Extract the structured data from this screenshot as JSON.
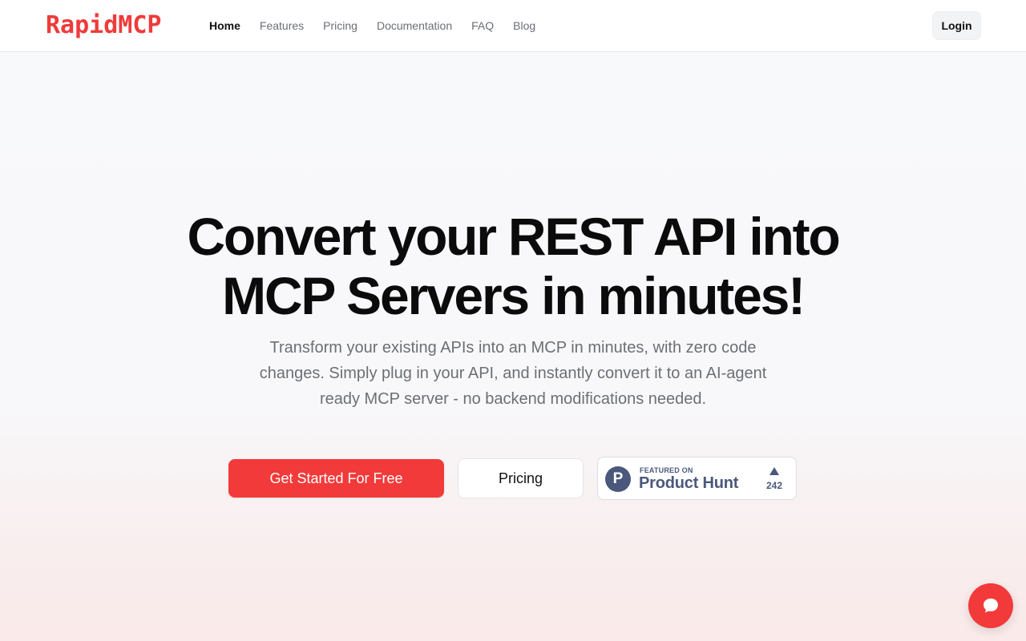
{
  "header": {
    "logo": "RapidMCP",
    "nav": [
      "Home",
      "Features",
      "Pricing",
      "Documentation",
      "FAQ",
      "Blog"
    ],
    "login_label": "Login"
  },
  "hero": {
    "title_line1": "Convert your REST API into",
    "title_line2": "MCP Servers in minutes!",
    "subtitle": "Transform your existing APIs into an MCP in minutes, with zero code changes. Simply plug in your API, and instantly convert it to an AI-agent ready MCP server - no backend modifications needed.",
    "primary_cta": "Get Started For Free",
    "secondary_cta": "Pricing"
  },
  "product_hunt": {
    "logo_letter": "P",
    "featured_label": "FEATURED ON",
    "name": "Product Hunt",
    "votes": "242"
  },
  "icons": {
    "chat": "chat-bubble-icon",
    "upvote": "upvote-arrow-icon"
  },
  "colors": {
    "brand": "#f23a3a",
    "product_hunt": "#4b587c"
  }
}
